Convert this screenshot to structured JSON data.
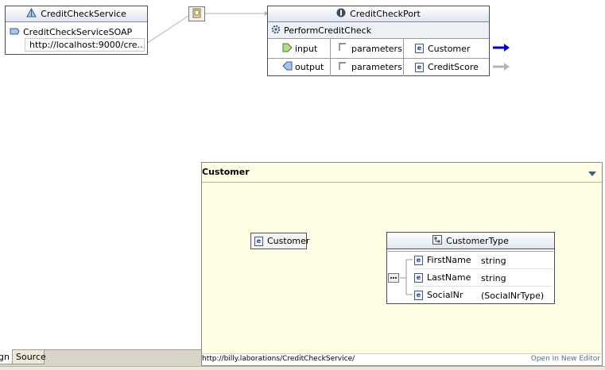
{
  "service": {
    "title": "CreditCheckService",
    "port_name": "CreditCheckServiceSOAP",
    "address": "http://localhost:9000/cre..."
  },
  "port_type": {
    "title": "CreditCheckPort",
    "operation": "PerformCreditCheck",
    "rows": [
      {
        "direction": "input",
        "part": "parameters",
        "element": "Customer"
      },
      {
        "direction": "output",
        "part": "parameters",
        "element": "CreditScore"
      }
    ]
  },
  "schema_panel": {
    "title": "Customer",
    "element_name": "Customer",
    "type_name": "CustomerType",
    "fields": [
      {
        "name": "FirstName",
        "type": "string"
      },
      {
        "name": "LastName",
        "type": "string"
      },
      {
        "name": "SocialNr",
        "type": "(SocialNrType)"
      }
    ],
    "namespace": "http://billy.laborations/CreditCheckService/",
    "open_editor_link": "Open In New Editor"
  },
  "tabs": [
    {
      "label": "gn"
    },
    {
      "label": "Source"
    }
  ],
  "colors": {
    "header_gradient_end": "#dfe6f1",
    "panel_bg": "#ffffe6",
    "active_arrow": "#0000cc",
    "inactive_arrow": "#b5b5b5"
  }
}
